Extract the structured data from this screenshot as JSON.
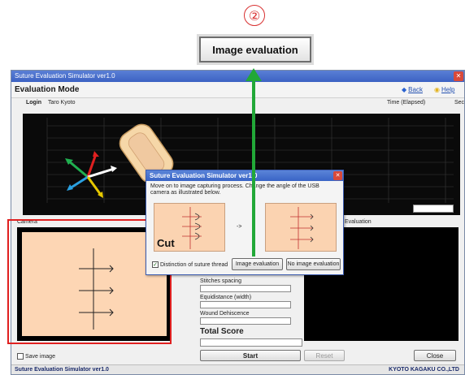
{
  "step_badge": "②",
  "callout_button_label": "Image evaluation",
  "main_window": {
    "title": "Suture Evaluation Simulator ver1.0",
    "close_glyph": "✕",
    "mode_title": "Evaluation Mode",
    "back_label": "Back",
    "help_label": "Help",
    "login_label": "Login",
    "login_user": "Taro Kyoto",
    "time_label": "Time (Elapsed)",
    "sec_label": "Sec",
    "camera_section_label": "Camera",
    "preview_section_label": "Evaluation",
    "fields": {
      "stitches_spacing": "Stitches spacing",
      "equidistance": "Equidistance (width)",
      "wound_dehiscence": "Wound Dehiscence"
    },
    "total_score_label": "Total Score",
    "start_label": "Start",
    "reset_label": "Reset",
    "close_label": "Close",
    "save_image_label": "Save image",
    "status_left": "Suture Evaluation Simulator ver1.0",
    "status_right": "KYOTO KAGAKU CO.,LTD"
  },
  "dialog": {
    "title": "Suture Evaluation Simulator ver1.0",
    "close_glyph": "✕",
    "message": "Move on to image capturing process. Change the angle of the USB camera as illustrated below.",
    "cut_label": "Cut",
    "arrow_text": "->",
    "distinction_label": "Distinction of suture thread",
    "image_eval_label": "Image evaluation",
    "no_image_eval_label": "No image evaluation"
  },
  "colors": {
    "accent_red": "#e02020",
    "arrow_green": "#22a838",
    "skin": "#fdd6b4"
  }
}
